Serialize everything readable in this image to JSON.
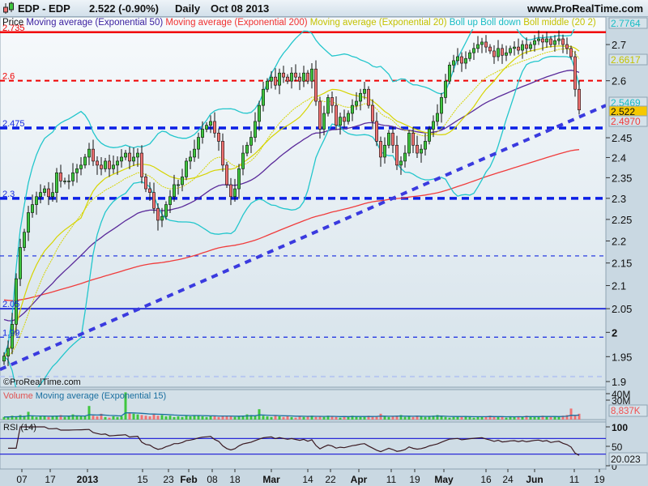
{
  "header": {
    "symbol": "EDP - EDP",
    "quote": "2.522 (-0.90%)",
    "period": "Daily",
    "date": "Oct 08 2013",
    "site": "www.ProRealTime.com"
  },
  "legend": {
    "price": "Price",
    "ema50": "Moving average (Exponential 50)",
    "ema200": "Moving average (Exponential 200)",
    "ema20": "Moving average (Exponential 20)",
    "boll_up": "Boll up",
    "boll_down": "Boll down",
    "boll_middle": "Boll middle (20 2)"
  },
  "watermark": "©ProRealTime.com",
  "colors": {
    "up": "#3fc63f",
    "down": "#f07272",
    "ema50": "#5a2a9a",
    "ema200": "#f03c3c",
    "ema20": "#d6d400",
    "boll": "#22c6cc",
    "level_blue": "#1428e0",
    "level_red": "#f00000"
  },
  "chart_data": {
    "type": "candlestick",
    "title": "EDP - EDP Daily",
    "scale": "log",
    "ylim": [
      1.89,
      2.79
    ],
    "yticks": [
      "1.9",
      "1.95",
      "2",
      "2.05",
      "2.1",
      "2.15",
      "2.2",
      "2.25",
      "2.3",
      "2.35",
      "2.4",
      "2.45",
      "2.6",
      "2.7"
    ],
    "closes": [
      1.951,
      1.967,
      2.017,
      2.115,
      2.185,
      2.22,
      2.266,
      2.285,
      2.304,
      2.314,
      2.323,
      2.304,
      2.314,
      2.362,
      2.342,
      2.342,
      2.342,
      2.362,
      2.372,
      2.381,
      2.401,
      2.421,
      2.391,
      2.381,
      2.372,
      2.391,
      2.372,
      2.381,
      2.391,
      2.401,
      2.411,
      2.391,
      2.401,
      2.411,
      2.352,
      2.323,
      2.314,
      2.276,
      2.248,
      2.257,
      2.285,
      2.304,
      2.333,
      2.333,
      2.352,
      2.391,
      2.401,
      2.421,
      2.451,
      2.472,
      2.482,
      2.492,
      2.462,
      2.441,
      2.381,
      2.333,
      2.304,
      2.323,
      2.372,
      2.411,
      2.431,
      2.451,
      2.492,
      2.534,
      2.577,
      2.599,
      2.61,
      2.588,
      2.621,
      2.61,
      2.599,
      2.621,
      2.61,
      2.599,
      2.621,
      2.599,
      2.632,
      2.545,
      2.472,
      2.513,
      2.555,
      2.534,
      2.482,
      2.503,
      2.492,
      2.513,
      2.534,
      2.545,
      2.566,
      2.577,
      2.534,
      2.492,
      2.441,
      2.401,
      2.431,
      2.462,
      2.431,
      2.381,
      2.391,
      2.411,
      2.462,
      2.431,
      2.411,
      2.421,
      2.441,
      2.472,
      2.492,
      2.513,
      2.555,
      2.599,
      2.643,
      2.655,
      2.666,
      2.648,
      2.661,
      2.677,
      2.689,
      2.7,
      2.707,
      2.693,
      2.682,
      2.666,
      2.689,
      2.67,
      2.677,
      2.689,
      2.693,
      2.684,
      2.7,
      2.689,
      2.7,
      2.711,
      2.716,
      2.707,
      2.716,
      2.7,
      2.711,
      2.716,
      2.7,
      2.689,
      2.666,
      2.577,
      2.522
    ],
    "ema50_seed": 2.03,
    "ema200_seed": 2.07,
    "levels": [
      {
        "price": 2.735,
        "label": "2.735",
        "style": "solid-red"
      },
      {
        "price": 2.6,
        "label": "2.6",
        "style": "dashed-red"
      },
      {
        "price": 2.475,
        "label": "2.475",
        "style": "thick-dashed-blue"
      },
      {
        "price": 2.3,
        "label": "2.3",
        "style": "thick-dashed-blue"
      },
      {
        "price": 2.166,
        "label": "",
        "style": "thin-dashed-blue"
      },
      {
        "price": 2.05,
        "label": "2.05",
        "style": "solid-blue"
      },
      {
        "price": 1.99,
        "label": "1.99",
        "style": "thin-dashed-blue"
      },
      {
        "price": 1.91,
        "label": "",
        "style": "faint-dashed"
      }
    ],
    "trendline": {
      "start_price": 1.924,
      "end_price": 2.534
    },
    "value_tags": [
      {
        "label": "2.7764",
        "price": 2.7764,
        "kind": "boll"
      },
      {
        "label": "2.6617",
        "price": 2.6617,
        "kind": "ema20"
      },
      {
        "label": "2.5469",
        "price": 2.5469,
        "kind": "boll"
      },
      {
        "label": "2.522",
        "price": 2.522,
        "kind": "last"
      },
      {
        "label": "2.4970",
        "price": 2.497,
        "kind": "ema200"
      }
    ],
    "volume": {
      "title": "Volume",
      "ma_label": "Moving average (Exponential 15)",
      "yticks": [
        "40M",
        "30M"
      ],
      "last": "8,837K",
      "values_millions": [
        4,
        5,
        6,
        5,
        7,
        6,
        12,
        5,
        4,
        6,
        5,
        4,
        5,
        6,
        7,
        4,
        5,
        8,
        6,
        5,
        5,
        21,
        6,
        5,
        9,
        4,
        3,
        5,
        4,
        5,
        42,
        11,
        9,
        8,
        7,
        6,
        5,
        8,
        6,
        7,
        5,
        6,
        4,
        5,
        4,
        6,
        5,
        7,
        6,
        5,
        4,
        5,
        6,
        4,
        5,
        6,
        5,
        4,
        5,
        6,
        8,
        7,
        6,
        16,
        6,
        5,
        4,
        6,
        5,
        4,
        5,
        4,
        3,
        5,
        4,
        5,
        6,
        4,
        5,
        4,
        6,
        5,
        4,
        3,
        5,
        4,
        6,
        5,
        4,
        5,
        6,
        4,
        5,
        9,
        5,
        4,
        5,
        6,
        7,
        4,
        5,
        4,
        6,
        5,
        4,
        5,
        6,
        7,
        5,
        4,
        3,
        4,
        5,
        4,
        5,
        4,
        3,
        5,
        4,
        5,
        6,
        4,
        5,
        4,
        3,
        5,
        4,
        5,
        4,
        6,
        5,
        4,
        5,
        6,
        5,
        4,
        5,
        4,
        6,
        7,
        17,
        6,
        9
      ]
    },
    "rsi": {
      "title": "RSI (14)",
      "yticks": [
        "100",
        "50",
        "0"
      ],
      "levels": [
        70,
        30
      ],
      "last": "20.023"
    },
    "xlabels": [
      {
        "i": 4.4,
        "label": "07",
        "bold": false
      },
      {
        "i": 11.4,
        "label": "17",
        "bold": false
      },
      {
        "i": 20.6,
        "label": "2013",
        "bold": true
      },
      {
        "i": 34.2,
        "label": "15",
        "bold": false
      },
      {
        "i": 40.6,
        "label": "23",
        "bold": false
      },
      {
        "i": 45.6,
        "label": "Feb",
        "bold": true
      },
      {
        "i": 51.4,
        "label": "08",
        "bold": false
      },
      {
        "i": 57,
        "label": "18",
        "bold": false
      },
      {
        "i": 66,
        "label": "Mar",
        "bold": true
      },
      {
        "i": 75,
        "label": "14",
        "bold": false
      },
      {
        "i": 80.6,
        "label": "22",
        "bold": false
      },
      {
        "i": 87.6,
        "label": "Apr",
        "bold": true
      },
      {
        "i": 95.6,
        "label": "11",
        "bold": false
      },
      {
        "i": 101.4,
        "label": "19",
        "bold": false
      },
      {
        "i": 108.6,
        "label": "May",
        "bold": true
      },
      {
        "i": 119,
        "label": "16",
        "bold": false
      },
      {
        "i": 124.4,
        "label": "24",
        "bold": false
      },
      {
        "i": 131,
        "label": "Jun",
        "bold": true
      },
      {
        "i": 140.8,
        "label": "11",
        "bold": false
      },
      {
        "i": 147,
        "label": "19",
        "bold": false
      }
    ]
  }
}
